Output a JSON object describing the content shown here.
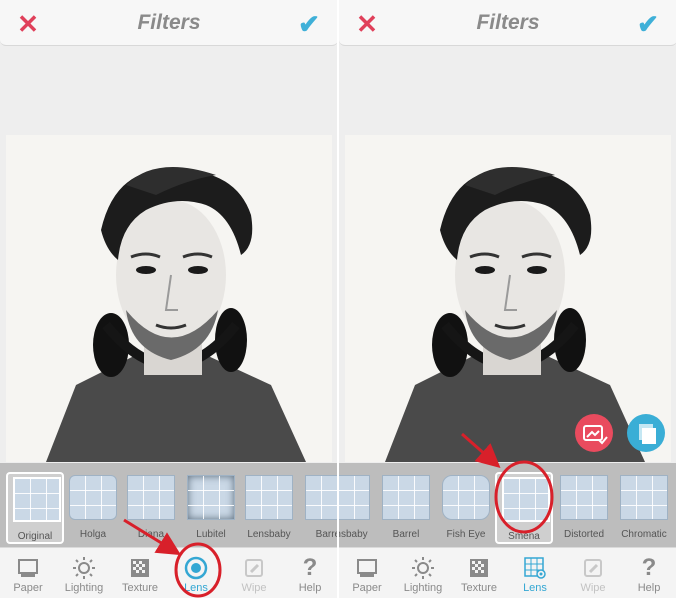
{
  "left": {
    "title": "Filters",
    "lenses": [
      "Original",
      "Holga",
      "Diana",
      "Lubitel",
      "Lensbaby",
      "Barrel"
    ],
    "selected_lens": "Original",
    "tabs": [
      "Paper",
      "Lighting",
      "Texture",
      "Lens",
      "Wipe",
      "Help"
    ],
    "active_tab": "Lens"
  },
  "right": {
    "title": "Filters",
    "lenses": [
      "Lensbaby",
      "Barrel",
      "Fish Eye",
      "Smena",
      "Distorted",
      "Chromatic"
    ],
    "selected_lens": "Smena",
    "tabs": [
      "Paper",
      "Lighting",
      "Texture",
      "Lens",
      "Wipe",
      "Help"
    ],
    "active_tab": "Lens"
  },
  "colors": {
    "accent": "#34a7d3",
    "cancel": "#e0405a",
    "annotation": "#d8202a"
  },
  "icons": {
    "cancel": "close-icon",
    "confirm": "checkmark-icon"
  }
}
